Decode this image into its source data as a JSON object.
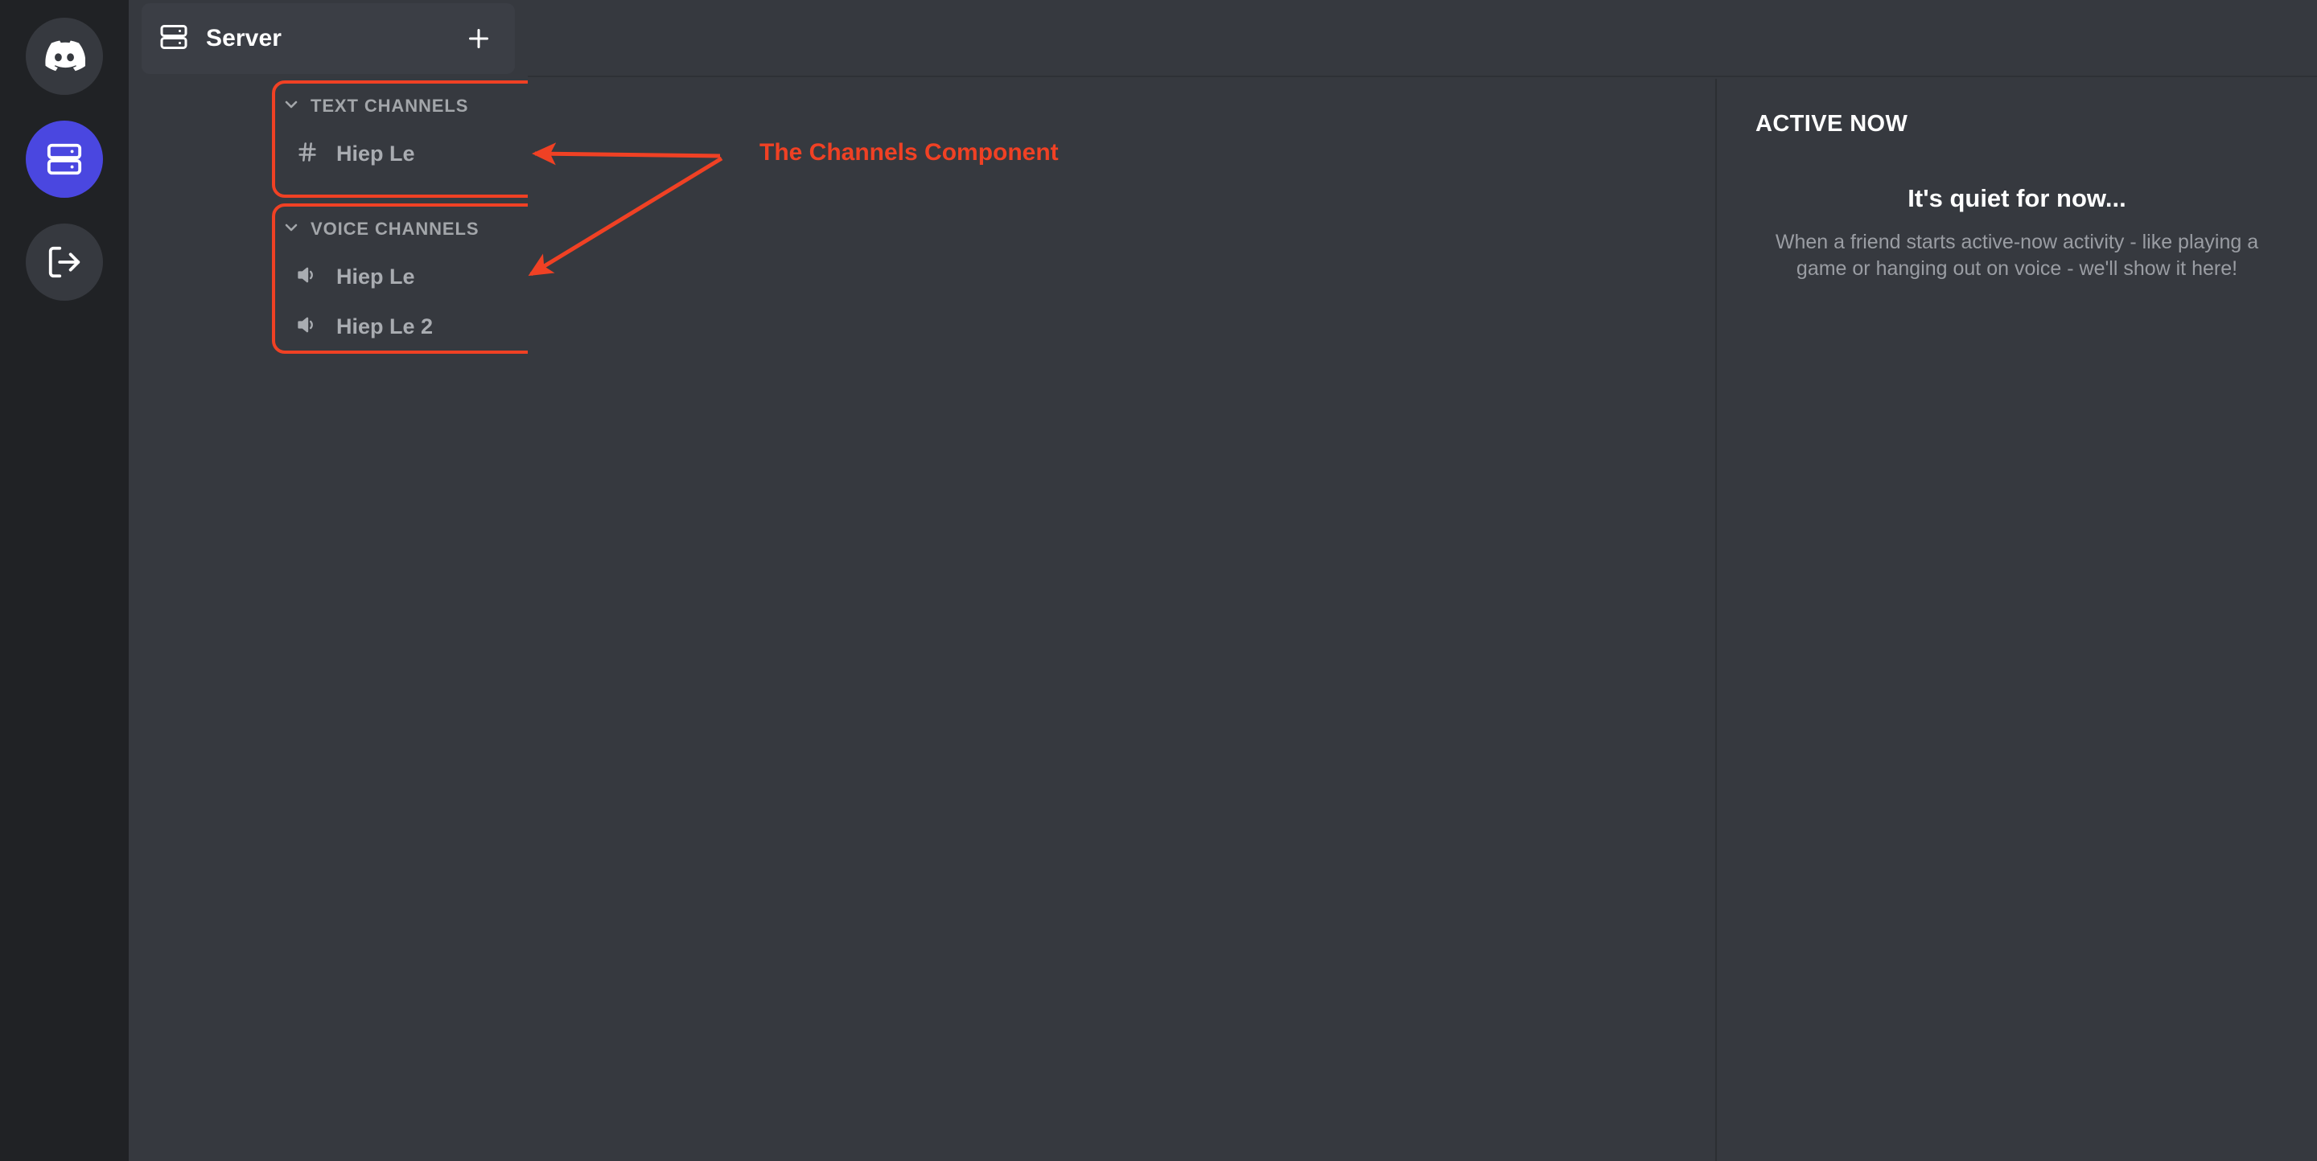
{
  "rail": {
    "items": [
      {
        "name": "discord-home",
        "icon": "discord-logo-icon",
        "active": false
      },
      {
        "name": "server",
        "icon": "server-icon",
        "active": true
      },
      {
        "name": "logout",
        "icon": "logout-icon",
        "active": false
      }
    ]
  },
  "sidebar": {
    "server_header": {
      "title": "Server",
      "icon": "server-icon",
      "add_label": "+"
    },
    "categories": [
      {
        "label": "TEXT CHANNELS",
        "collapse_icon": "chevron-down-icon",
        "channels": [
          {
            "name": "Hiep Le",
            "icon": "hash-icon"
          }
        ]
      },
      {
        "label": "VOICE CHANNELS",
        "collapse_icon": "chevron-down-icon",
        "channels": [
          {
            "name": "Hiep Le",
            "icon": "speaker-icon"
          },
          {
            "name": "Hiep Le 2",
            "icon": "speaker-icon"
          }
        ]
      }
    ]
  },
  "active_now": {
    "heading": "ACTIVE NOW",
    "empty_title": "It's quiet for now...",
    "empty_body": "When a friend starts active-now activity - like playing a game or hanging out on voice - we'll show it here!"
  },
  "annotation": {
    "label": "The Channels Component",
    "color": "#f04124"
  },
  "colors": {
    "rail_bg": "#202225",
    "sidebar_bg": "#36393f",
    "header_bg": "#3b3e45",
    "accent_blurple": "#4a47e0",
    "annotation": "#f04124",
    "muted_text": "#a3a6aa"
  }
}
